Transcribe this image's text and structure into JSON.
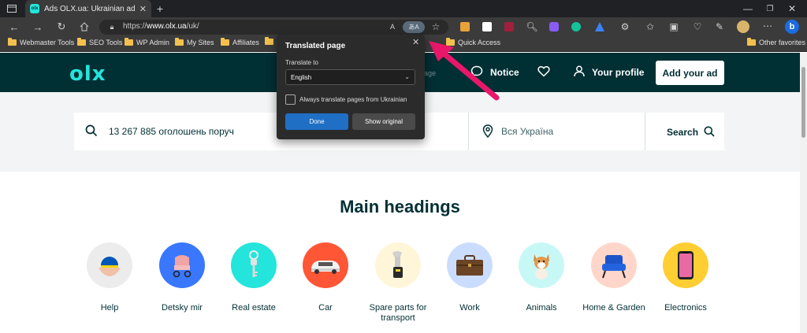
{
  "browser": {
    "tab_title": "Ads OLX.ua: Ukrainian ad service",
    "url_prefix": "https://",
    "url_domain": "www.olx.ua",
    "url_path": "/uk/",
    "bookmarks": [
      "Webmaster Tools",
      "SEO Tools",
      "WP Admin",
      "My Sites",
      "Affiliates",
      "Quick Access",
      "Other favorites"
    ]
  },
  "site": {
    "logo": "olx",
    "nav_notice_partial": "age",
    "nav_notice": "Notice",
    "nav_profile": "Your profile",
    "add_ad": "Add your ad"
  },
  "search": {
    "query": "13 267 885 оголошень поруч",
    "location": "Вся Україна",
    "button": "Search"
  },
  "main": {
    "heading": "Main headings",
    "categories": [
      {
        "label": "Help",
        "color": "#ececec"
      },
      {
        "label": "Detsky mir",
        "color": "#3a77ff"
      },
      {
        "label": "Real estate",
        "color": "#23e5db"
      },
      {
        "label": "Car",
        "color": "#ff5636"
      },
      {
        "label": "Spare parts for transport",
        "color": "#fff6d9"
      },
      {
        "label": "Work",
        "color": "#cbddff"
      },
      {
        "label": "Animals",
        "color": "#c8f8f6"
      },
      {
        "label": "Home & Garden",
        "color": "#ffd6c9"
      },
      {
        "label": "Electronics",
        "color": "#ffce32"
      }
    ]
  },
  "translate_popup": {
    "title": "Translated page",
    "translate_to_label": "Translate to",
    "language": "English",
    "checkbox_label": "Always translate pages from Ukrainian",
    "done": "Done",
    "show_original": "Show original"
  },
  "colors": {
    "brand_dark": "#002f34",
    "brand_accent": "#23e5db",
    "annotation_arrow": "#e8176a"
  }
}
